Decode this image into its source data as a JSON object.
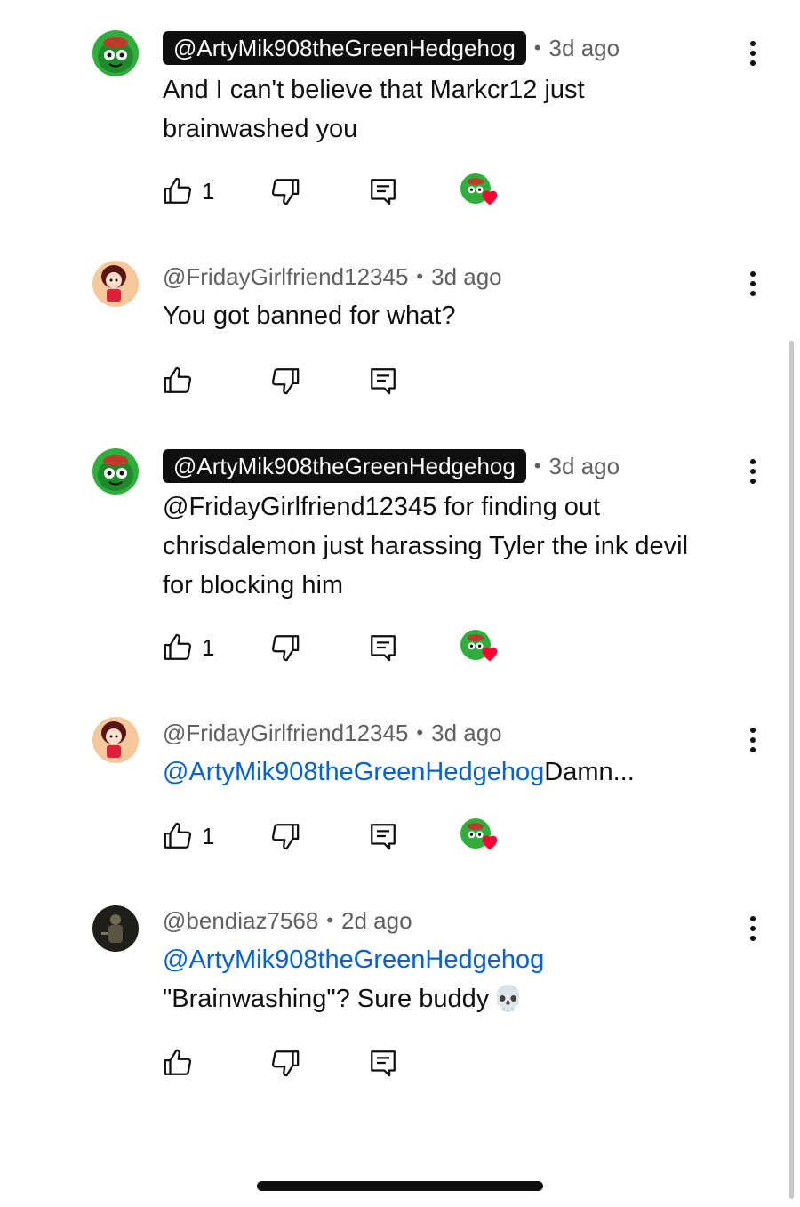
{
  "comments": [
    {
      "author": "@ArtyMik908theGreenHedgehog",
      "creator": true,
      "time": "3d ago",
      "mention": "",
      "text_lines": [
        "And I can't believe that Markcr12 just",
        "brainwashed you"
      ],
      "likes": "1",
      "hearted": true,
      "avatar": "green-hedgehog"
    },
    {
      "author": "@FridayGirlfriend12345",
      "creator": false,
      "time": "3d ago",
      "mention": "",
      "text_lines": [
        "You got banned for what?"
      ],
      "likes": "",
      "hearted": false,
      "avatar": "girlfriend"
    },
    {
      "author": "@ArtyMik908theGreenHedgehog",
      "creator": true,
      "time": "3d ago",
      "mention": "",
      "text_lines": [
        "@FridayGirlfriend12345 for finding out",
        "chrisdalemon just harassing Tyler the ink devil",
        "for blocking him"
      ],
      "likes": "1",
      "hearted": true,
      "avatar": "green-hedgehog"
    },
    {
      "author": "@FridayGirlfriend12345",
      "creator": false,
      "time": "3d ago",
      "mention": "@ArtyMik908theGreenHedgehog",
      "text_lines": [
        "Damn..."
      ],
      "likes": "1",
      "hearted": true,
      "avatar": "girlfriend"
    },
    {
      "author": "@bendiaz7568",
      "creator": false,
      "time": "2d ago",
      "mention": "@ArtyMik908theGreenHedgehog",
      "text_lines": [
        "\"Brainwashing\"? Sure buddy"
      ],
      "emoji": "💀",
      "likes": "",
      "hearted": false,
      "avatar": "dark-figure"
    }
  ],
  "icons": {
    "like": "thumbs-up-icon",
    "dislike": "thumbs-down-icon",
    "reply": "reply-comment-icon",
    "more": "more-vertical-icon",
    "heart": "creator-heart-icon"
  },
  "colors": {
    "mention": "#065fd4",
    "creator_badge_bg": "#0f0f0f",
    "heart": "#ff0033"
  }
}
